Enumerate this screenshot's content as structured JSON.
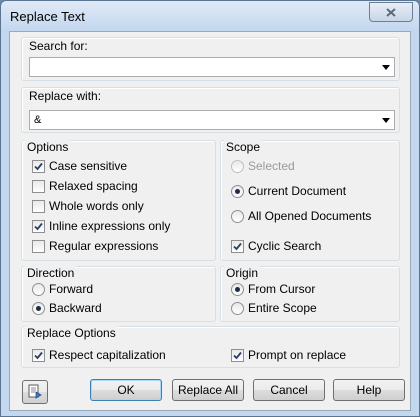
{
  "window": {
    "title": "Replace Text"
  },
  "search": {
    "label": "Search for:",
    "value": ""
  },
  "replace": {
    "label": "Replace with:",
    "value": "&"
  },
  "options": {
    "label": "Options",
    "items": [
      {
        "label": "Case sensitive",
        "checked": true
      },
      {
        "label": "Relaxed spacing",
        "checked": false
      },
      {
        "label": "Whole words only",
        "checked": false
      },
      {
        "label": "Inline expressions only",
        "checked": true
      },
      {
        "label": "Regular expressions",
        "checked": false
      }
    ]
  },
  "scope": {
    "label": "Scope",
    "items": [
      {
        "label": "Selected",
        "selected": false,
        "disabled": true
      },
      {
        "label": "Current Document",
        "selected": true,
        "disabled": false
      },
      {
        "label": "All Opened Documents",
        "selected": false,
        "disabled": false
      }
    ],
    "cyclic": {
      "label": "Cyclic Search",
      "checked": true
    }
  },
  "direction": {
    "label": "Direction",
    "items": [
      {
        "label": "Forward",
        "selected": false
      },
      {
        "label": "Backward",
        "selected": true
      }
    ]
  },
  "origin": {
    "label": "Origin",
    "items": [
      {
        "label": "From Cursor",
        "selected": true
      },
      {
        "label": "Entire Scope",
        "selected": false
      }
    ]
  },
  "replace_options": {
    "label": "Replace Options",
    "respect": {
      "label": "Respect capitalization",
      "checked": true
    },
    "prompt": {
      "label": "Prompt on replace",
      "checked": true
    }
  },
  "buttons": {
    "ok": "OK",
    "replace_all": "Replace All",
    "cancel": "Cancel",
    "help": "Help"
  }
}
